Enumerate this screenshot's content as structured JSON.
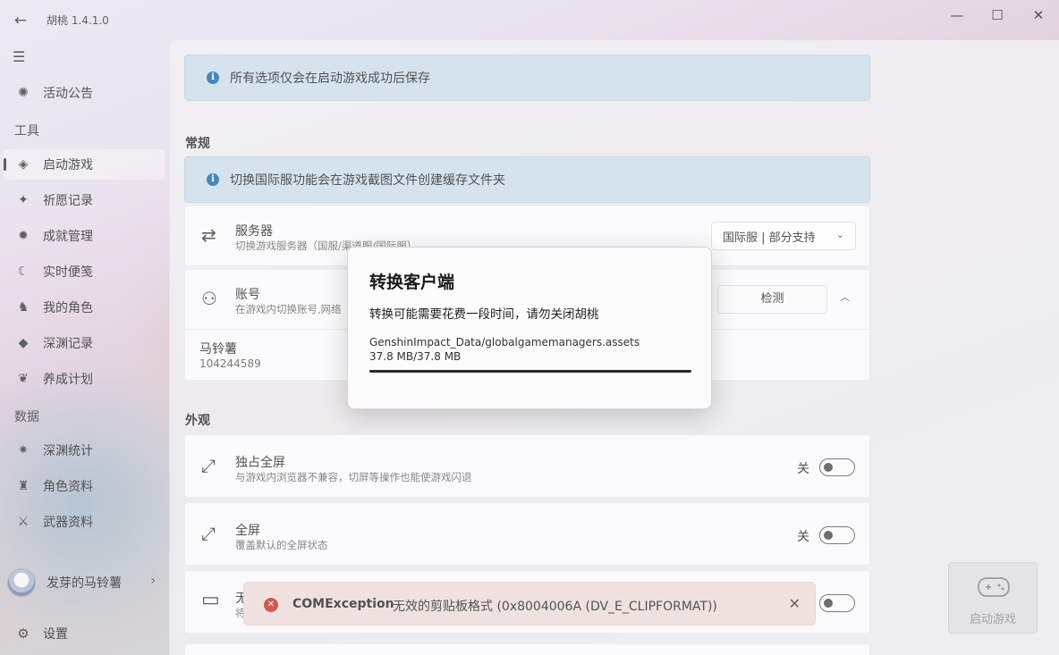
{
  "app": {
    "title": "胡桃 1.4.1.0"
  },
  "window": {
    "minimize": "—",
    "maximize": "☐",
    "close": "✕"
  },
  "sidebar": {
    "items_top": [
      {
        "label": "活动公告",
        "icon": "compass-icon"
      }
    ],
    "section_tools": "工具",
    "tools": [
      {
        "label": "启动游戏",
        "icon": "game-launch-icon",
        "active": true
      },
      {
        "label": "祈愿记录",
        "icon": "wish-star-icon"
      },
      {
        "label": "成就管理",
        "icon": "achievement-icon"
      },
      {
        "label": "实时便笺",
        "icon": "moon-note-icon"
      },
      {
        "label": "我的角色",
        "icon": "my-character-icon"
      },
      {
        "label": "深渊记录",
        "icon": "abyss-icon"
      },
      {
        "label": "养成计划",
        "icon": "cultivation-icon"
      }
    ],
    "section_data": "数据",
    "data_items": [
      {
        "label": "深渊统计",
        "icon": "abyss-stats-icon"
      },
      {
        "label": "角色资料",
        "icon": "character-wiki-icon"
      },
      {
        "label": "武器资料",
        "icon": "weapon-wiki-icon"
      }
    ],
    "user": {
      "name": "发芽的马铃薯"
    },
    "settings": {
      "label": "设置"
    }
  },
  "content": {
    "top_info": "所有选项仅会在启动游戏成功后保存",
    "section_general": "常规",
    "general_info": "切换国际服功能会在游戏截图文件创建缓存文件夹",
    "server": {
      "title": "服务器",
      "subtitle": "切换游戏服务器（国服/渠道服/国际服）",
      "value": "国际服 | 部分支持"
    },
    "account": {
      "title": "账号",
      "subtitle": "在游戏内切换账号,网络",
      "detect": "检测",
      "name": "马铃薯",
      "uid": "104244589"
    },
    "section_appearance": "外观",
    "exclusive_fullscreen": {
      "title": "独占全屏",
      "subtitle": "与游戏内浏览器不兼容，切屏等操作也能使游戏闪退",
      "state": "关"
    },
    "fullscreen": {
      "title": "全屏",
      "subtitle": "覆盖默认的全屏状态",
      "state": "关"
    },
    "borderless": {
      "title": "无",
      "subtitle": "将"
    }
  },
  "launch": {
    "label": "启动游戏"
  },
  "toast": {
    "title": "COMException",
    "message": "无效的剪贴板格式 (0x8004006A (DV_E_CLIPFORMAT))"
  },
  "dialog": {
    "title": "转换客户端",
    "description": "转换可能需要花费一段时间，请勿关闭胡桃",
    "file": "GenshinImpact_Data/globalgamemanagers.assets",
    "size": "37.8 MB/37.8 MB",
    "progress": 1.0
  }
}
